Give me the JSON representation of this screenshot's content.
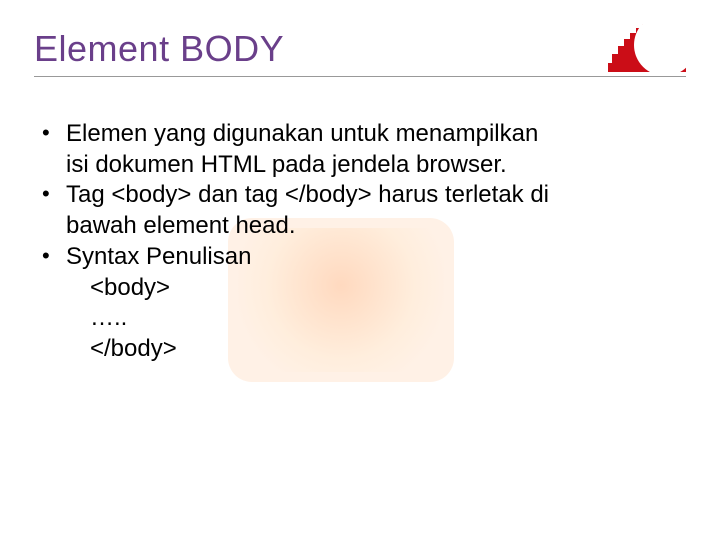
{
  "title": "Element BODY",
  "bullets": {
    "b1_l1": "Elemen yang digunakan untuk menampilkan",
    "b1_l2": "isi dokumen HTML pada jendela browser.",
    "b2_l1": "Tag <body> dan tag </body> harus terletak di",
    "b2_l2": "bawah element head.",
    "b3_l1": "Syntax Penulisan",
    "b3_l2": "<body>",
    "b3_l3": "…..",
    "b3_l4": "</body>"
  }
}
